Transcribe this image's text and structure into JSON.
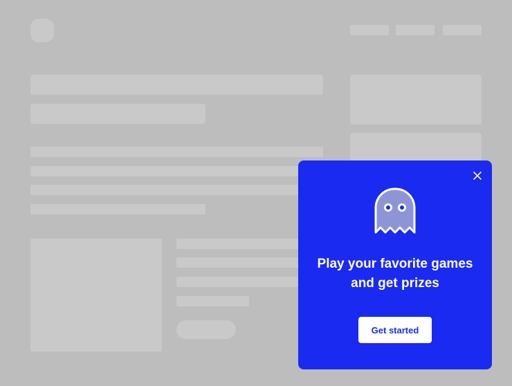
{
  "modal": {
    "headline": "Play your favorite games and get prizes",
    "cta_label": "Get started",
    "accent_color": "#1a2af0",
    "icons": {
      "close": "close-icon",
      "mascot": "ghost-icon"
    }
  }
}
